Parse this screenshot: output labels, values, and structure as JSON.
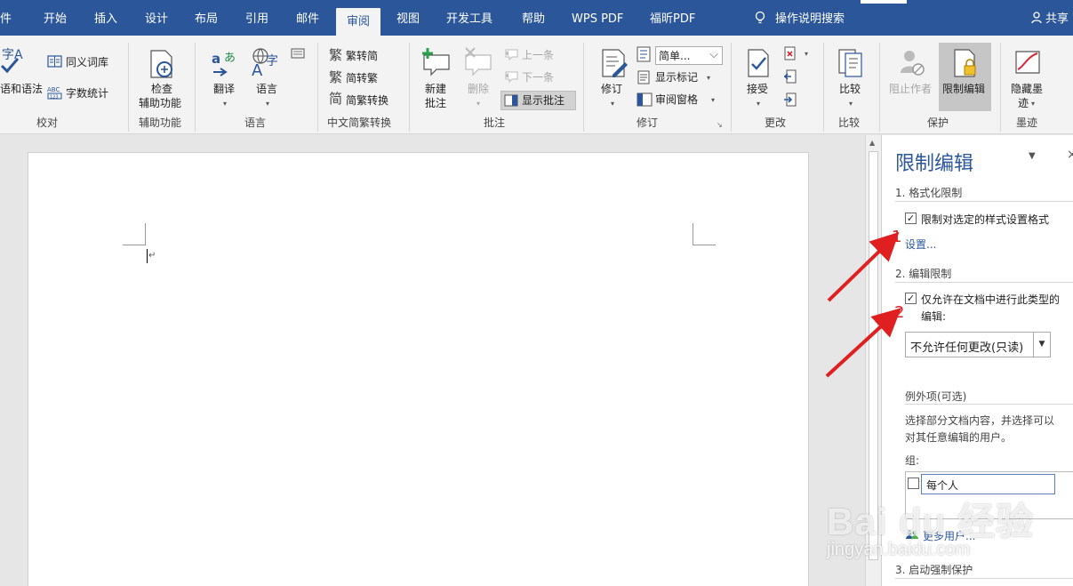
{
  "tabs": [
    {
      "label": "件"
    },
    {
      "label": "开始"
    },
    {
      "label": "插入"
    },
    {
      "label": "设计"
    },
    {
      "label": "布局"
    },
    {
      "label": "引用"
    },
    {
      "label": "邮件"
    },
    {
      "label": "审阅"
    },
    {
      "label": "视图"
    },
    {
      "label": "开发工具"
    },
    {
      "label": "帮助"
    },
    {
      "label": "WPS PDF"
    },
    {
      "label": "福昕PDF"
    }
  ],
  "tell_me": "操作说明搜索",
  "share": "共享",
  "ribbon": {
    "proofing": {
      "spell": "语和语法",
      "thesaurus": "同义词库",
      "wordcount": "字数统计",
      "group": "校对"
    },
    "accessibility": {
      "check_line1": "检查",
      "check_line2": "辅助功能",
      "group": "辅助功能"
    },
    "language": {
      "translate": "翻译",
      "language": "语言",
      "group": "语言"
    },
    "chinese": {
      "to_simplified": "繁转简",
      "to_traditional": "简转繁",
      "convert": "简繁转换",
      "group": "中文简繁转换"
    },
    "comments": {
      "new_line1": "新建",
      "new_line2": "批注",
      "delete": "删除",
      "prev": "上一条",
      "next": "下一条",
      "show": "显示批注",
      "group": "批注"
    },
    "tracking": {
      "track": "修订",
      "simple": "简单...",
      "show_markup": "显示标记",
      "review_pane": "审阅窗格",
      "group": "修订"
    },
    "changes": {
      "accept": "接受",
      "group": "更改"
    },
    "compare": {
      "compare": "比较",
      "group": "比较"
    },
    "protect": {
      "block_authors": "阻止作者",
      "restrict": "限制编辑",
      "group": "保护"
    },
    "ink": {
      "hide_line1": "隐藏墨",
      "hide_line2": "迹",
      "group": "墨迹"
    }
  },
  "pane": {
    "title": "限制编辑",
    "sec1": "1. 格式化限制",
    "chk1": "限制对选定的样式设置格式",
    "settings": "设置...",
    "sec2": "2. 编辑限制",
    "chk2": "仅允许在文档中进行此类型的",
    "chk2b": "编辑:",
    "select_value": "不允许任何更改(只读)",
    "exceptions": "例外项(可选)",
    "exc_line1": "选择部分文档内容，并选择可以",
    "exc_line2": "对其任意编辑的用户。",
    "groups": "组:",
    "everyone": "每个人",
    "more_users": "更多用户...",
    "sec3": "3. 启动强制保护"
  },
  "annotations": {
    "one": "1",
    "two": "2"
  },
  "watermark": {
    "main": "Bai du 经验",
    "url": "jingyan.baidu.com"
  }
}
